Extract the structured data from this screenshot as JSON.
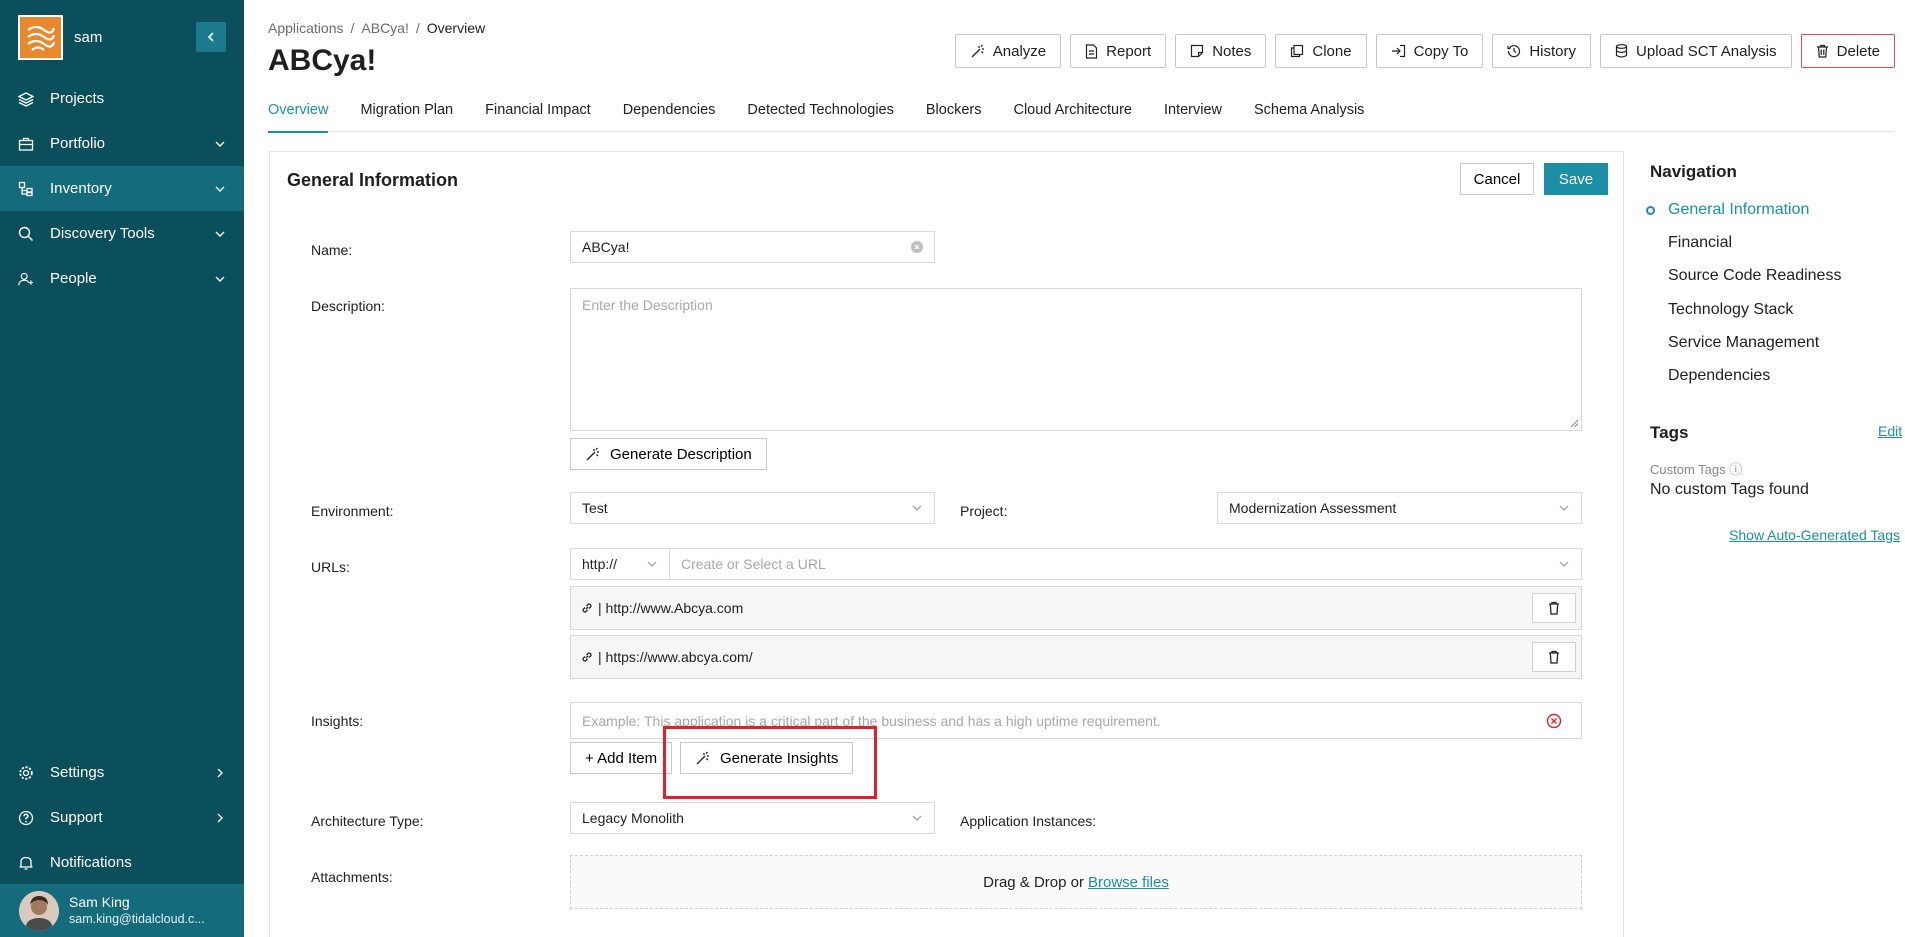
{
  "sidebar": {
    "org_name": "sam",
    "items": [
      {
        "label": "Projects",
        "icon": "layers-icon"
      },
      {
        "label": "Portfolio",
        "icon": "briefcase-icon"
      },
      {
        "label": "Inventory",
        "icon": "inventory-icon"
      },
      {
        "label": "Discovery Tools",
        "icon": "search-icon"
      },
      {
        "label": "People",
        "icon": "people-icon"
      }
    ],
    "bottom_items": [
      {
        "label": "Settings",
        "icon": "gear-icon"
      },
      {
        "label": "Support",
        "icon": "help-icon"
      },
      {
        "label": "Notifications",
        "icon": "bell-icon"
      }
    ],
    "user": {
      "name": "Sam King",
      "email": "sam.king@tidalcloud.c..."
    }
  },
  "breadcrumb": [
    "Applications",
    "ABCya!",
    "Overview"
  ],
  "page_title": "ABCya!",
  "toolbar": [
    "Analyze",
    "Report",
    "Notes",
    "Clone",
    "Copy To",
    "History",
    "Upload SCT Analysis",
    "Delete"
  ],
  "tabs": [
    "Overview",
    "Migration Plan",
    "Financial Impact",
    "Dependencies",
    "Detected Technologies",
    "Blockers",
    "Cloud Architecture",
    "Interview",
    "Schema Analysis"
  ],
  "form": {
    "title": "General Information",
    "cancel": "Cancel",
    "save": "Save",
    "name_label": "Name:",
    "name_value": "ABCya!",
    "description_label": "Description:",
    "description_placeholder": "Enter the Description",
    "generate_description": "Generate Description",
    "environment_label": "Environment:",
    "environment_value": "Test",
    "project_label": "Project:",
    "project_value": "Modernization Assessment",
    "urls_label": "URLs:",
    "url_protocol": "http://",
    "url_placeholder": "Create or Select a URL",
    "urls": [
      "| http://www.Abcya.com",
      "| https://www.abcya.com/"
    ],
    "insights_label": "Insights:",
    "insights_placeholder": "Example: This application is a critical part of the business and has a high uptime requirement.",
    "add_item": "+ Add Item",
    "generate_insights": "Generate Insights",
    "architecture_label": "Architecture Type:",
    "architecture_value": "Legacy Monolith",
    "instances_label": "Application Instances:",
    "attachments_label": "Attachments:",
    "dropzone_text": "Drag & Drop or",
    "browse_files": "Browse files"
  },
  "right_panel": {
    "title": "Navigation",
    "items": [
      "General Information",
      "Financial",
      "Source Code Readiness",
      "Technology Stack",
      "Service Management",
      "Dependencies"
    ],
    "tags_title": "Tags",
    "tags_edit": "Edit",
    "custom_tags_label": "Custom Tags ⓘ",
    "no_tags": "No custom Tags found",
    "auto_tags": "Show Auto-Generated Tags"
  },
  "colors": {
    "sidebar": "#0b4f5c",
    "accent": "#1b8fa6",
    "highlight": "#e0202a"
  }
}
